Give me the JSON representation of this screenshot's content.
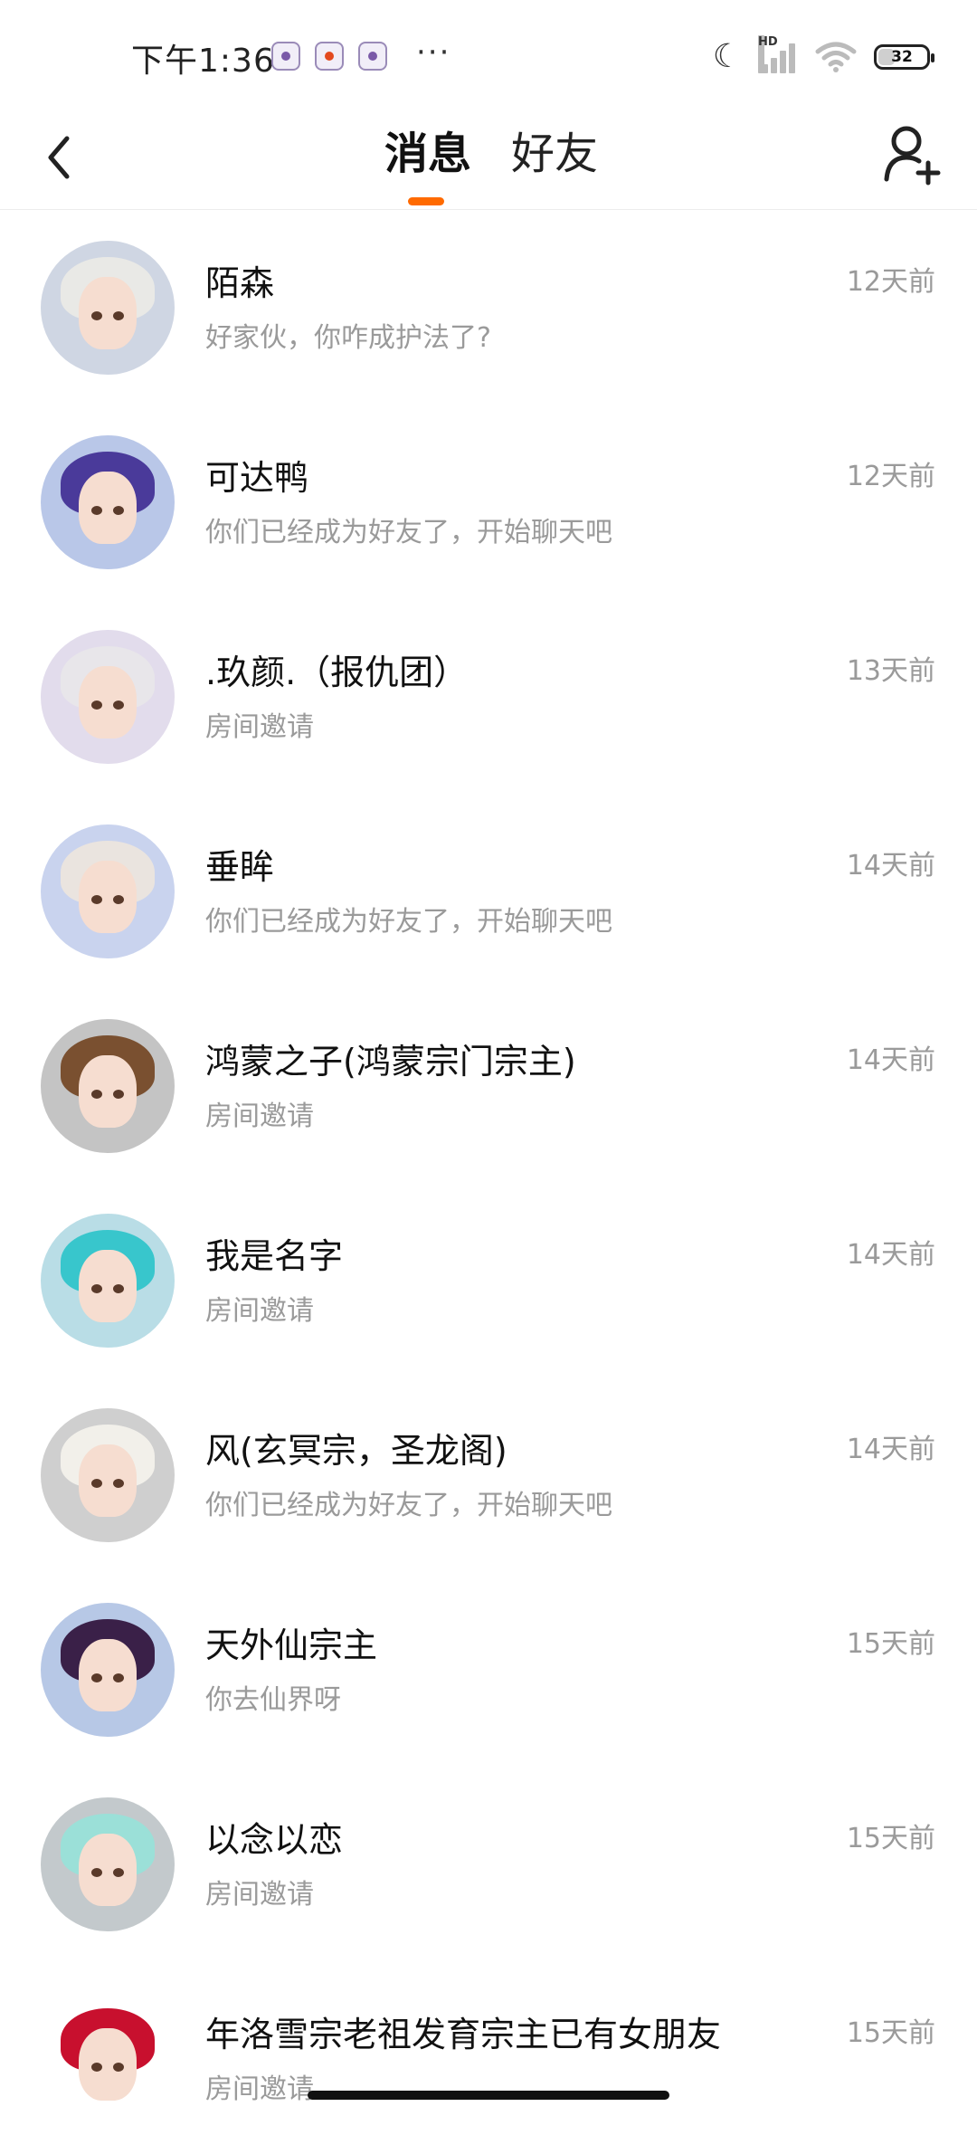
{
  "status_bar": {
    "time": "下午1:36",
    "more": "···",
    "battery": "32",
    "network": "HD"
  },
  "header": {
    "tabs": [
      {
        "label": "消息",
        "active": true
      },
      {
        "label": "好友",
        "active": false
      }
    ],
    "accent_color": "#ff6a00"
  },
  "conversations": [
    {
      "name": "陌森",
      "preview": "好家伙，你咋成护法了?",
      "time": "12天前",
      "avatar": {
        "bg": "#cfd6e3",
        "hair": "#e9e9e6"
      }
    },
    {
      "name": "可达鸭",
      "preview": "你们已经成为好友了，开始聊天吧",
      "time": "12天前",
      "avatar": {
        "bg": "#b9c7e8",
        "hair": "#4a3a9a"
      }
    },
    {
      "name": ".玖颜.（报仇团）",
      "preview": "房间邀请",
      "time": "13天前",
      "avatar": {
        "bg": "#e2dcec",
        "hair": "#e8e6ea"
      }
    },
    {
      "name": "垂眸",
      "preview": "你们已经成为好友了，开始聊天吧",
      "time": "14天前",
      "avatar": {
        "bg": "#c9d3ee",
        "hair": "#eae4df"
      }
    },
    {
      "name": "鸿蒙之子(鸿蒙宗门宗主)",
      "preview": "房间邀请",
      "time": "14天前",
      "avatar": {
        "bg": "#c4c4c4",
        "hair": "#7a5030"
      }
    },
    {
      "name": "我是名字",
      "preview": "房间邀请",
      "time": "14天前",
      "avatar": {
        "bg": "#b9dde6",
        "hair": "#38c6cc"
      }
    },
    {
      "name": "风(玄冥宗，圣龙阁)",
      "preview": "你们已经成为好友了，开始聊天吧",
      "time": "14天前",
      "avatar": {
        "bg": "#cfcfcf",
        "hair": "#f2f0ea"
      }
    },
    {
      "name": "天外仙宗主",
      "preview": "你去仙界呀",
      "time": "15天前",
      "avatar": {
        "bg": "#b7c8e6",
        "hair": "#3a2048"
      }
    },
    {
      "name": "以念以恋",
      "preview": "房间邀请",
      "time": "15天前",
      "avatar": {
        "bg": "#c3c9cc",
        "hair": "#9be0d8"
      }
    },
    {
      "name": "年洛雪宗老祖发育宗主已有女朋友",
      "preview": "房间邀请",
      "time": "15天前",
      "avatar": {
        "bg": "#ffffff",
        "hair": "#c8102e"
      }
    }
  ]
}
